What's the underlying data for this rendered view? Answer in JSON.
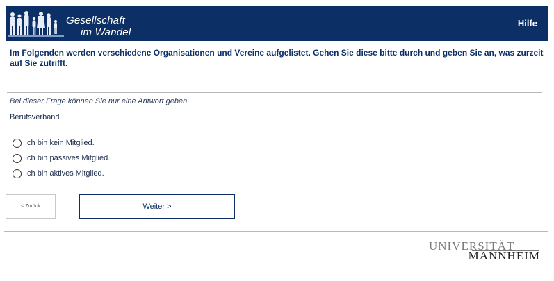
{
  "header": {
    "logo_line1": "Gesellschaft",
    "logo_line2": "im Wandel",
    "help_label": "Hilfe",
    "logo_icon": "people-silhouettes-icon",
    "background_color": "#0c3066"
  },
  "question": {
    "title": "Im Folgenden werden verschiedene Organisationen und Vereine aufgelistet. Gehen Sie diese bitte durch und geben Sie an, was zurzeit auf Sie zutrifft.",
    "instruction": "Bei dieser Frage können Sie nur eine Antwort geben.",
    "item_label": "Berufsverband",
    "options": [
      {
        "label": "Ich bin kein Mitglied.",
        "selected": false
      },
      {
        "label": "Ich bin passives Mitglied.",
        "selected": false
      },
      {
        "label": "Ich bin aktives Mitglied.",
        "selected": false
      }
    ]
  },
  "navigation": {
    "back_label": "< Zurück",
    "next_label": "Weiter >"
  },
  "footer": {
    "university_line1": "UNIVERSITÄT",
    "university_line2": "MANNHEIM"
  }
}
